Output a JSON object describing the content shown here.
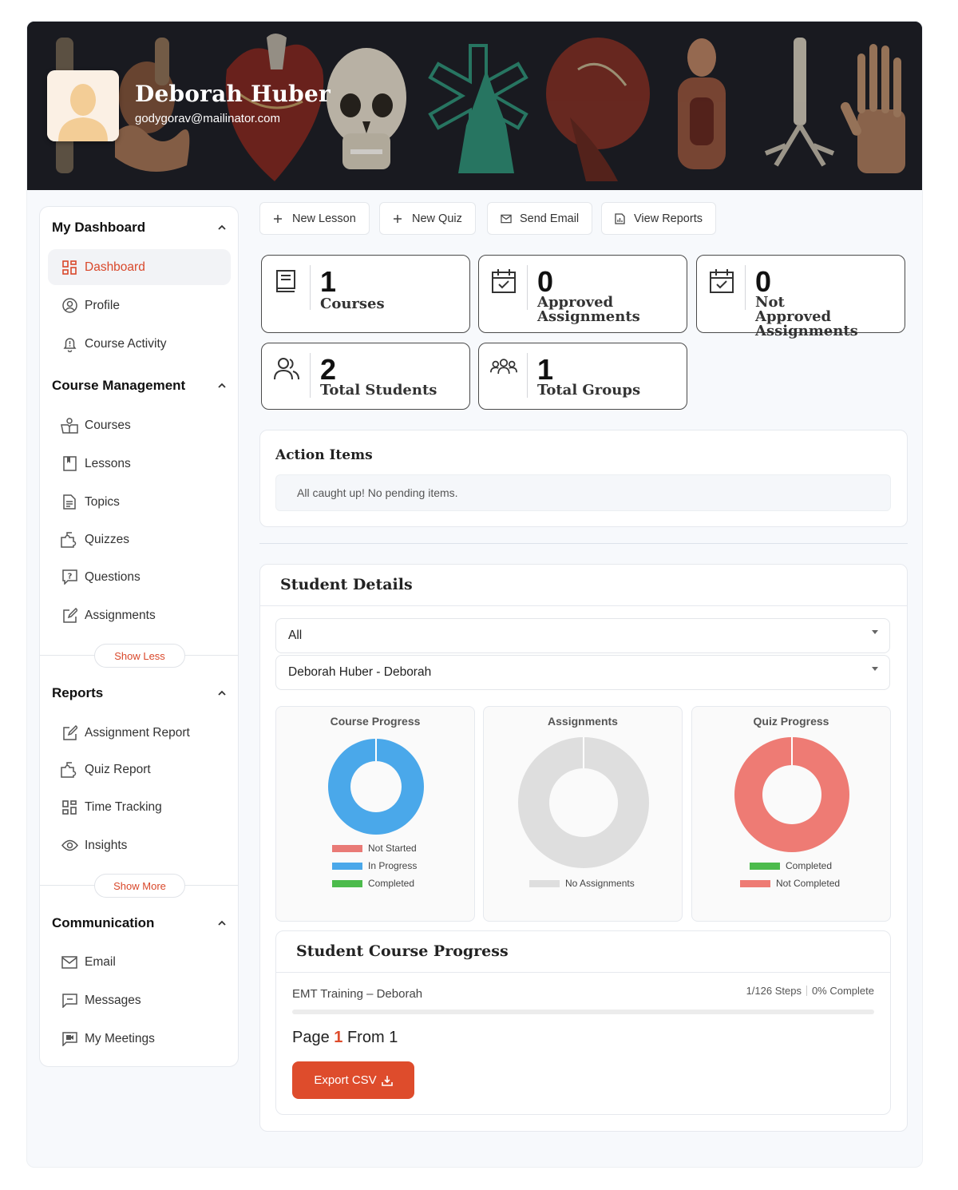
{
  "profile": {
    "name": "Deborah Huber",
    "email": "godygorav@mailinator.com"
  },
  "sidebar": {
    "sections": [
      {
        "title": "My Dashboard",
        "items": [
          {
            "label": "Dashboard",
            "icon": "dashboard-grid-icon",
            "active": true
          },
          {
            "label": "Profile",
            "icon": "user-circle-icon"
          },
          {
            "label": "Course Activity",
            "icon": "bell-alert-icon"
          }
        ]
      },
      {
        "title": "Course Management",
        "items": [
          {
            "label": "Courses",
            "icon": "book-open-user-icon"
          },
          {
            "label": "Lessons",
            "icon": "bookmark-book-icon"
          },
          {
            "label": "Topics",
            "icon": "document-icon"
          },
          {
            "label": "Quizzes",
            "icon": "puzzle-icon"
          },
          {
            "label": "Questions",
            "icon": "question-box-icon"
          },
          {
            "label": "Assignments",
            "icon": "edit-note-icon"
          }
        ],
        "toggle": "Show Less"
      },
      {
        "title": "Reports",
        "items": [
          {
            "label": "Assignment Report",
            "icon": "edit-note-icon"
          },
          {
            "label": "Quiz Report",
            "icon": "puzzle-icon"
          },
          {
            "label": "Time Tracking",
            "icon": "dashboard-grid-icon"
          },
          {
            "label": "Insights",
            "icon": "eye-icon"
          }
        ],
        "toggle": "Show More"
      },
      {
        "title": "Communication",
        "items": [
          {
            "label": "Email",
            "icon": "mail-icon"
          },
          {
            "label": "Messages",
            "icon": "message-icon"
          },
          {
            "label": "My Meetings",
            "icon": "video-icon"
          }
        ]
      }
    ]
  },
  "toolbar": {
    "new_lesson": "New Lesson",
    "new_quiz": "New Quiz",
    "send_email": "Send Email",
    "view_reports": "View Reports"
  },
  "stats": [
    {
      "value": "1",
      "label": "Courses",
      "icon": "book-icon"
    },
    {
      "value": "0",
      "label": "Approved Assignments",
      "icon": "calendar-check-icon"
    },
    {
      "value": "0",
      "label": "Not Approved Assignments",
      "icon": "calendar-check-icon"
    },
    {
      "value": "2",
      "label": "Total Students",
      "icon": "users-icon"
    },
    {
      "value": "1",
      "label": "Total Groups",
      "icon": "group-icon"
    }
  ],
  "action_items": {
    "title": "Action Items",
    "message": "All caught up! No pending items."
  },
  "student_details": {
    "title": "Student Details",
    "filter_group": "All",
    "filter_student": "Deborah Huber - Deborah"
  },
  "chart_data": [
    {
      "type": "pie",
      "title": "Course Progress",
      "labels": [
        "Not Started",
        "In Progress",
        "Completed"
      ],
      "values": [
        0,
        1,
        0
      ],
      "colors": [
        "#e97a76",
        "#4aa8ea",
        "#4cbb4c"
      ]
    },
    {
      "type": "pie",
      "title": "Assignments",
      "labels": [
        "No Assignments"
      ],
      "values": [
        1
      ],
      "colors": [
        "#dedede"
      ]
    },
    {
      "type": "pie",
      "title": "Quiz Progress",
      "labels": [
        "Completed",
        "Not Completed"
      ],
      "values": [
        0,
        1
      ],
      "colors": [
        "#4cbb4c",
        "#ee7b74"
      ]
    }
  ],
  "course_progress": {
    "title": "Student Course Progress",
    "course_name": "EMT Training – Deborah",
    "steps": "1/126 Steps",
    "percent_label": "0% Complete",
    "percent": 0
  },
  "pagination": {
    "prefix": "Page",
    "current": "1",
    "middle": "From",
    "total": "1"
  },
  "export_label": "Export CSV",
  "colors": {
    "accent": "#de4c2c",
    "banner_bg": "#1e1f26"
  }
}
